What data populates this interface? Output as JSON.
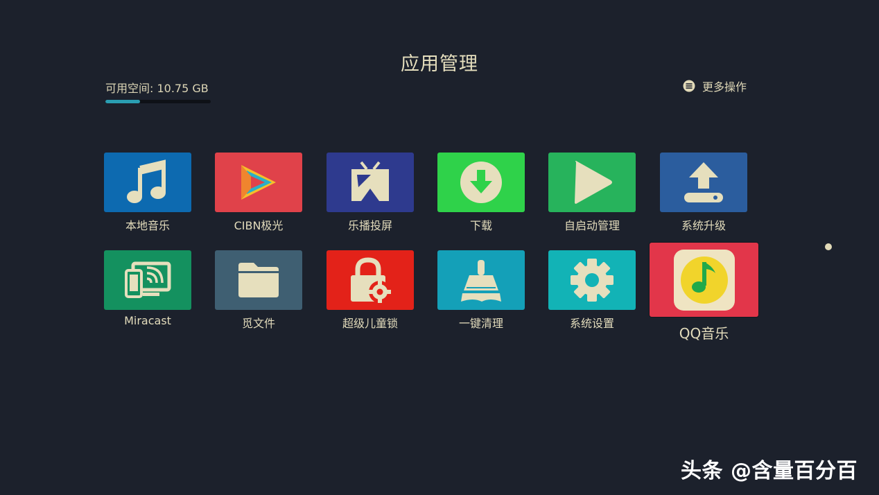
{
  "header": {
    "title": "应用管理",
    "storage_label": "可用空间: 10.75 GB",
    "storage_used_fraction": 0.33,
    "more_label": "更多操作"
  },
  "apps": [
    {
      "label": "本地音乐",
      "color": "#0d6ab0",
      "icon": "music-note-icon"
    },
    {
      "label": "CIBN极光",
      "color": "#e0424a",
      "icon": "cibn-logo-icon"
    },
    {
      "label": "乐播投屏",
      "color": "#2e3a8e",
      "icon": "tv-cast-icon"
    },
    {
      "label": "下载",
      "color": "#2fd24a",
      "icon": "download-icon"
    },
    {
      "label": "自启动管理",
      "color": "#27b35c",
      "icon": "play-icon"
    },
    {
      "label": "系统升级",
      "color": "#2b5d9e",
      "icon": "upgrade-icon"
    },
    {
      "label": "Miracast",
      "color": "#14915f",
      "icon": "miracast-icon"
    },
    {
      "label": "觅文件",
      "color": "#3f5f72",
      "icon": "folder-icon"
    },
    {
      "label": "超级儿童锁",
      "color": "#e32219",
      "icon": "lock-gear-icon"
    },
    {
      "label": "一键清理",
      "color": "#14a0b8",
      "icon": "broom-icon"
    },
    {
      "label": "系统设置",
      "color": "#12b3b6",
      "icon": "gear-icon"
    },
    {
      "label": "QQ音乐",
      "color": "#e2364a",
      "icon": "qq-music-icon",
      "focused": true
    }
  ],
  "watermark": "头条 @含量百分百"
}
